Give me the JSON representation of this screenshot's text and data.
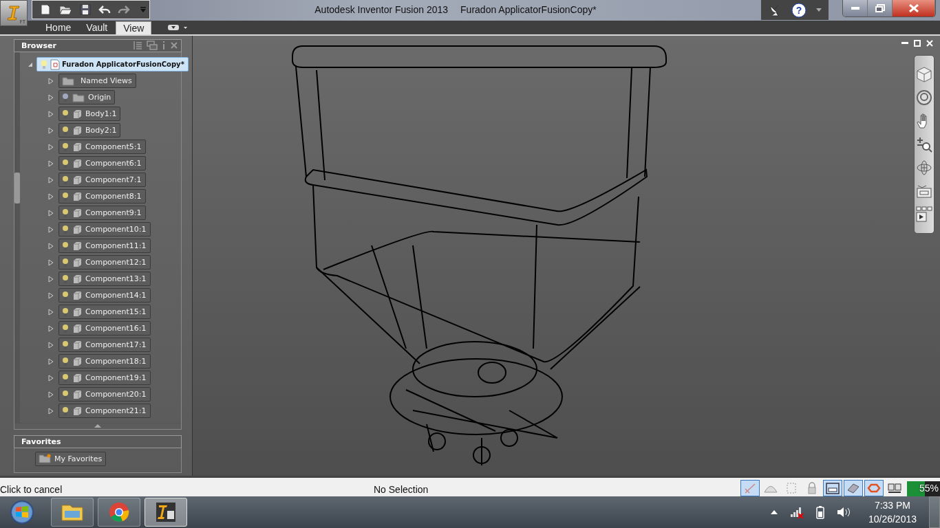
{
  "window": {
    "app_title": "Autodesk Inventor Fusion 2013",
    "document_title": "Furadon ApplicatorFusionCopy*",
    "app_badge": "FT",
    "help_glyph": "?"
  },
  "tabs": [
    {
      "label": "Home",
      "selected": false
    },
    {
      "label": "Vault",
      "selected": false
    },
    {
      "label": "View",
      "selected": true
    }
  ],
  "browser": {
    "title": "Browser",
    "root": {
      "label": "Furadon ApplicatorFusionCopy*",
      "selected": true,
      "expanded": true,
      "children": [
        {
          "label": "Named Views",
          "kind": "views",
          "expanded": false
        },
        {
          "label": "Origin",
          "kind": "origin",
          "expanded": false
        },
        {
          "label": "Body1:1",
          "kind": "part",
          "expanded": false
        },
        {
          "label": "Body2:1",
          "kind": "part",
          "expanded": false
        },
        {
          "label": "Component5:1",
          "kind": "part",
          "expanded": false
        },
        {
          "label": "Component6:1",
          "kind": "part",
          "expanded": false
        },
        {
          "label": "Component7:1",
          "kind": "part",
          "expanded": false
        },
        {
          "label": "Component8:1",
          "kind": "part",
          "expanded": false
        },
        {
          "label": "Component9:1",
          "kind": "part",
          "expanded": false
        },
        {
          "label": "Component10:1",
          "kind": "part",
          "expanded": false
        },
        {
          "label": "Component11:1",
          "kind": "part",
          "expanded": false
        },
        {
          "label": "Component12:1",
          "kind": "part",
          "expanded": false
        },
        {
          "label": "Component13:1",
          "kind": "part",
          "expanded": false
        },
        {
          "label": "Component14:1",
          "kind": "part",
          "expanded": false
        },
        {
          "label": "Component15:1",
          "kind": "part",
          "expanded": false
        },
        {
          "label": "Component16:1",
          "kind": "part",
          "expanded": false
        },
        {
          "label": "Component17:1",
          "kind": "part",
          "expanded": false
        },
        {
          "label": "Component18:1",
          "kind": "part",
          "expanded": false
        },
        {
          "label": "Component19:1",
          "kind": "part",
          "expanded": false
        },
        {
          "label": "Component20:1",
          "kind": "part",
          "expanded": false
        },
        {
          "label": "Component21:1",
          "kind": "part",
          "expanded": false
        }
      ]
    }
  },
  "favorites": {
    "title": "Favorites",
    "items": [
      "My Favorites"
    ]
  },
  "status_bar": {
    "message": "Click to cancel",
    "selection": "No Selection",
    "toggles": [
      {
        "kind": "check",
        "selected": true
      },
      {
        "kind": "arch",
        "selected": false
      },
      {
        "kind": "frame",
        "selected": false
      },
      {
        "kind": "lock",
        "selected": false
      },
      {
        "kind": "span",
        "selected": true
      },
      {
        "kind": "grid",
        "selected": true
      },
      {
        "kind": "loop",
        "selected": true
      },
      {
        "kind": "pair",
        "selected": false
      }
    ],
    "meter": {
      "reading": "55%",
      "level": 0.55
    }
  },
  "taskbar": {
    "apps": [
      {
        "kind": "explorer",
        "selected": false
      },
      {
        "kind": "chrome",
        "selected": false
      },
      {
        "kind": "inventor",
        "selected": true
      }
    ],
    "time": "7:33 PM",
    "date": "10/26/2013"
  }
}
